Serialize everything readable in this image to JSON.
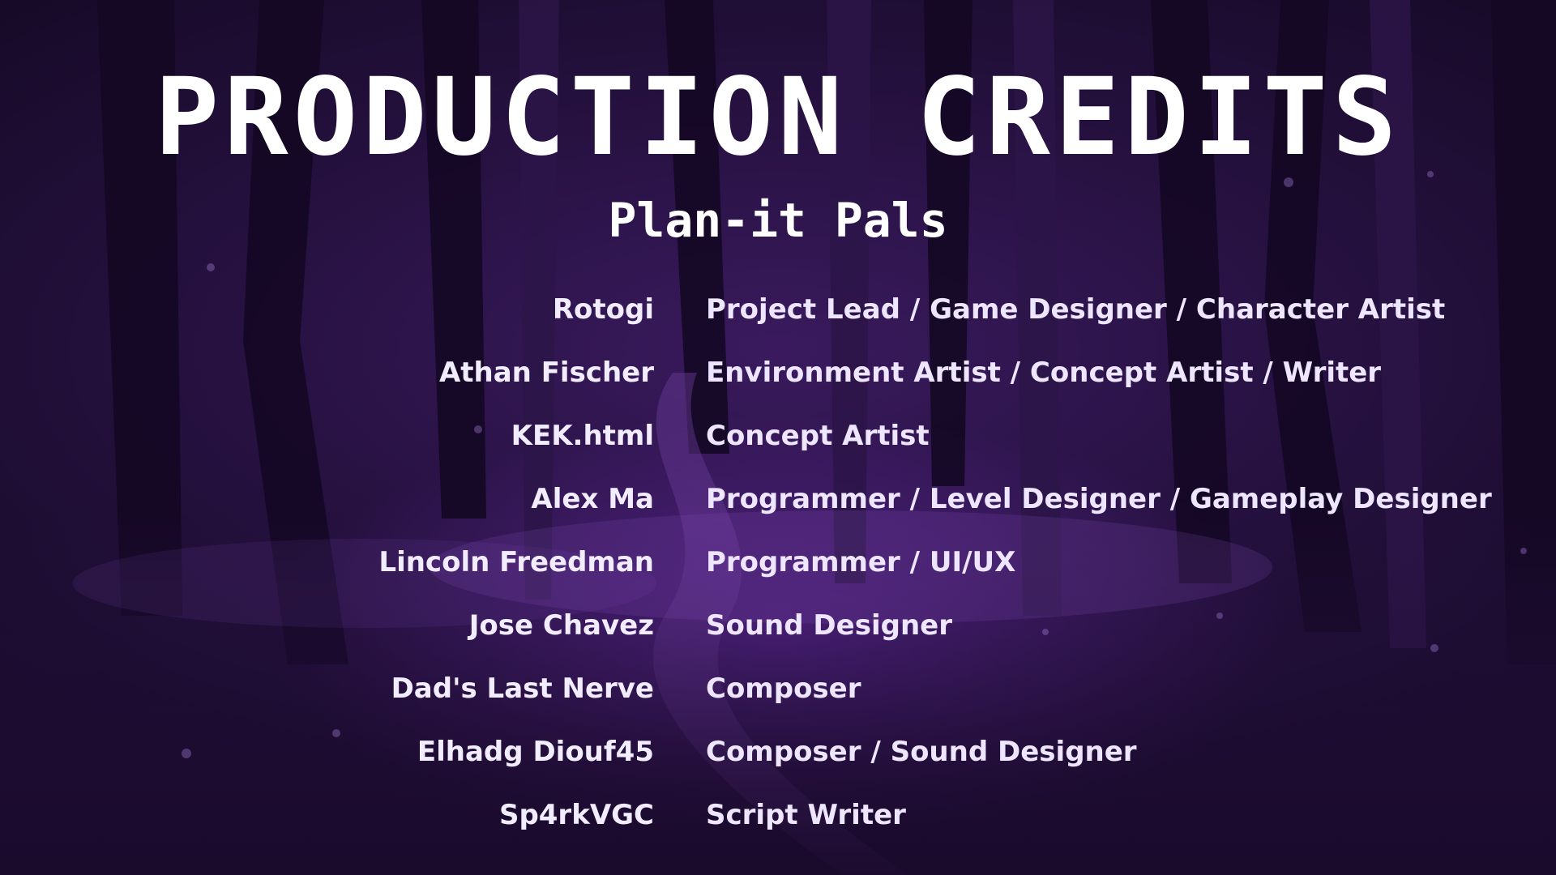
{
  "screen": {
    "title": "PRODUCTION CREDITS",
    "subtitle": "Plan-it Pals"
  },
  "credits": [
    {
      "name": "Rotogi",
      "role": "Project Lead / Game Designer / Character Artist"
    },
    {
      "name": "Athan Fischer",
      "role": "Environment Artist / Concept Artist / Writer"
    },
    {
      "name": "KEK.html",
      "role": "Concept Artist"
    },
    {
      "name": "Alex Ma",
      "role": "Programmer / Level Designer / Gameplay Designer"
    },
    {
      "name": "Lincoln Freedman",
      "role": "Programmer / UI/UX"
    },
    {
      "name": "Jose Chavez",
      "role": "Sound Designer"
    },
    {
      "name": "Dad's Last Nerve",
      "role": "Composer"
    },
    {
      "name": "Elhadg Diouf45",
      "role": "Composer / Sound Designer"
    },
    {
      "name": "Sp4rkVGC",
      "role": "Script Writer"
    }
  ],
  "colors": {
    "background": "#24103d",
    "text": "#ffffff",
    "glow": "#7832be"
  }
}
